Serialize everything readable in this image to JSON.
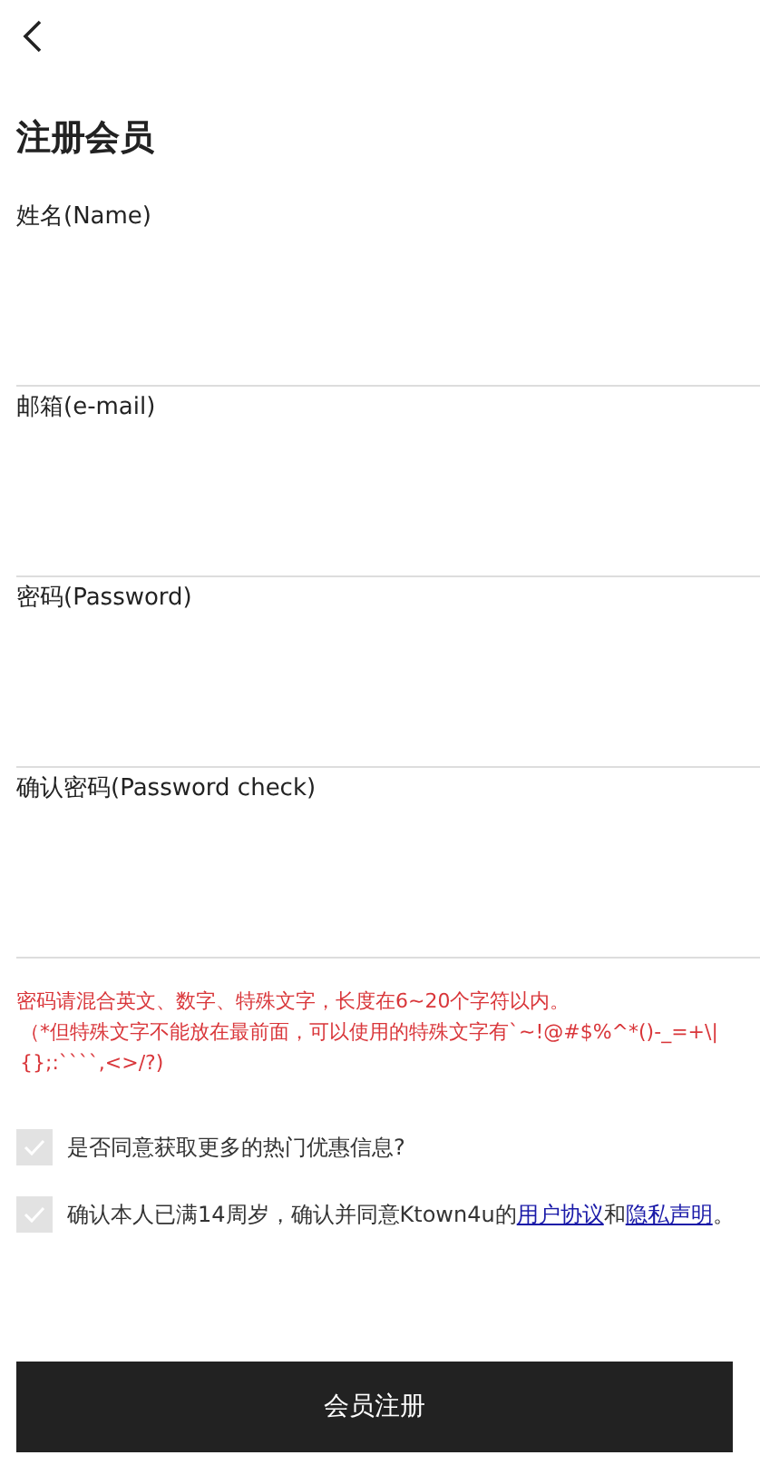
{
  "title": "注册会员",
  "fields": [
    {
      "label": "姓名(Name)"
    },
    {
      "label": "邮箱(e-mail)"
    },
    {
      "label": "密码(Password)"
    },
    {
      "label": "确认密码(Password check)"
    }
  ],
  "password_hint": [
    "密码请混合英文、数字、特殊文字，长度在6~20个字符以内。",
    "（*但特殊文字不能放在最前面，可以使用的特殊文字有`~!@#$%^*()-_=+\\|{};:````,<>/?)"
  ],
  "agreements": [
    {
      "text": "是否同意获取更多的热门优惠信息?",
      "checked": false
    },
    {
      "text": "确认本人已满14周岁，确认并同意Ktown4u的",
      "links": [
        "用户协议",
        "隐私声明"
      ],
      "joiner": "和",
      "end": "。",
      "checked": false
    }
  ],
  "submit_button": "会员注册"
}
